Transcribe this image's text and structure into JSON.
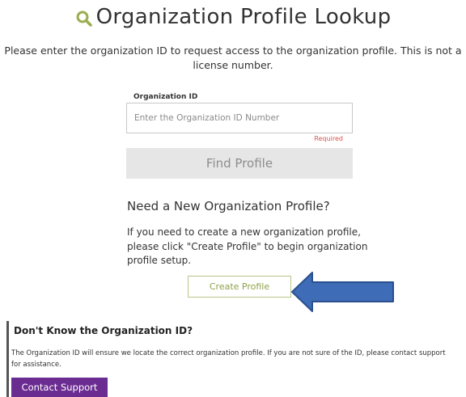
{
  "header": {
    "title": "Organization Profile Lookup",
    "icon": "search-icon"
  },
  "intro": {
    "text": "Please enter the organization ID to request access to the organization profile. This is not a license number."
  },
  "form": {
    "label": "Organization ID",
    "placeholder": "Enter the Organization ID Number",
    "value": "",
    "required_text": "Required",
    "find_button_label": "Find Profile"
  },
  "new_profile": {
    "heading": "Need a New Organization Profile?",
    "text": "If you need to create a new organization profile, please click \"Create Profile\" to begin organization profile setup.",
    "button_label": "Create Profile"
  },
  "help": {
    "heading": "Don't Know the Organization ID?",
    "text": "The Organization ID will ensure we locate the correct organization profile. If you are not sure of the ID, please contact support for assistance.",
    "button_label": "Contact Support"
  },
  "colors": {
    "accent_green": "#8ea04a",
    "support_purple": "#6b2c91",
    "arrow_blue": "#3f6cb7",
    "required_red": "#d9534f"
  }
}
